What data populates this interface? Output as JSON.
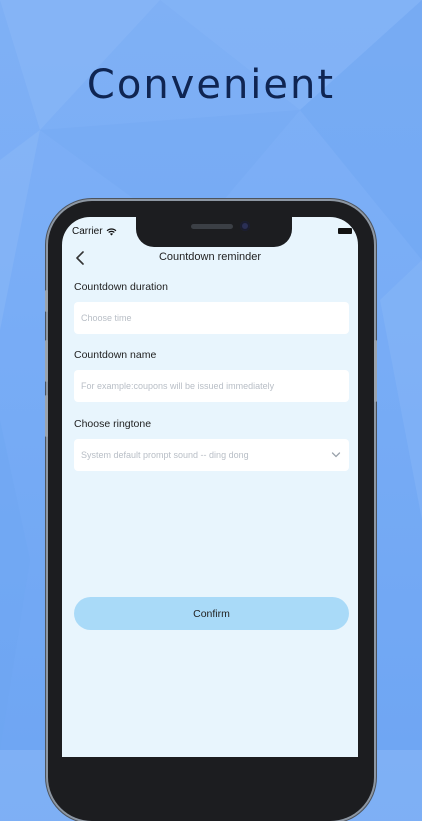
{
  "headline": "Convenient",
  "status_bar": {
    "carrier": "Carrier"
  },
  "nav": {
    "title": "Countdown reminder"
  },
  "form": {
    "duration": {
      "label": "Countdown duration",
      "placeholder": "Choose time"
    },
    "name": {
      "label": "Countdown name",
      "placeholder": "For example:coupons will be issued immediately"
    },
    "ringtone": {
      "label": "Choose ringtone",
      "value": "System default prompt sound -- ding dong"
    }
  },
  "confirm_label": "Confirm",
  "colors": {
    "background": "#79adf6",
    "headline": "#0f2552",
    "screen": "#e8f5fd",
    "confirm_button": "#a9daf8"
  },
  "icons": [
    "back-icon",
    "wifi-icon",
    "battery-icon",
    "chevron-down-icon"
  ]
}
